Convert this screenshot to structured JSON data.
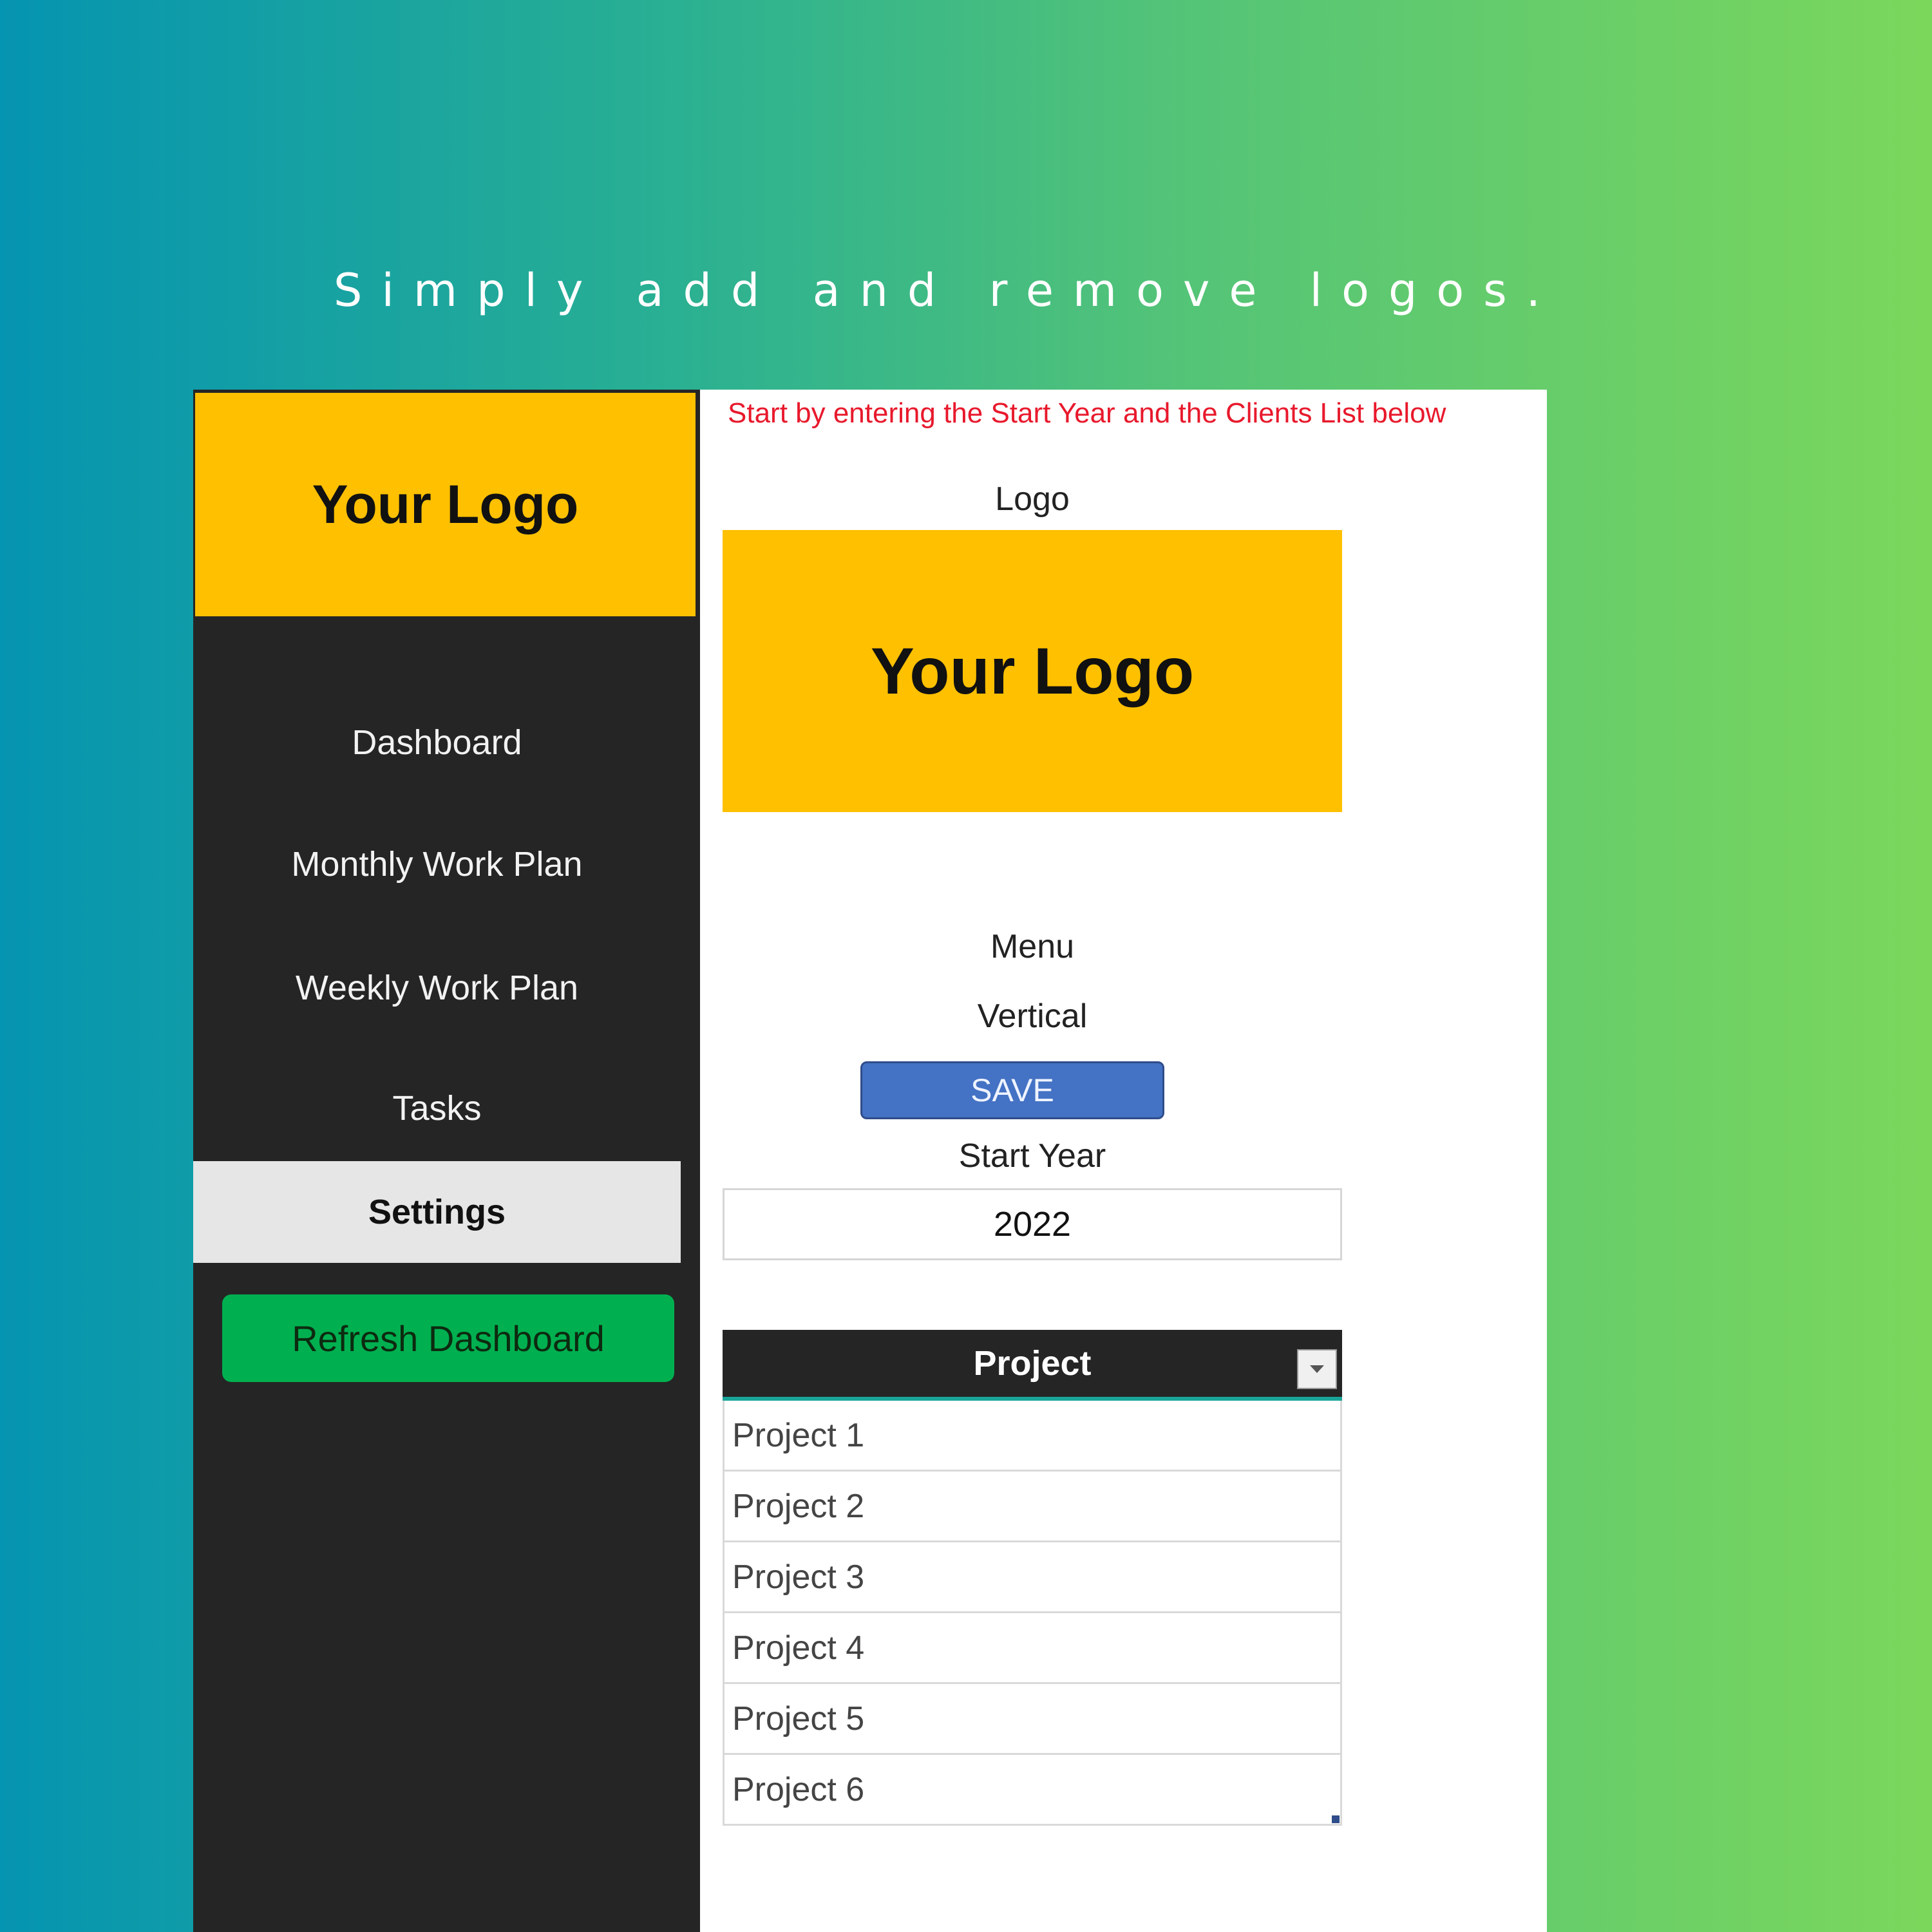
{
  "headline": "Simply add and remove logos.",
  "sidebar": {
    "logo_text": "Your Logo",
    "items": [
      {
        "label": "Dashboard"
      },
      {
        "label": "Monthly Work Plan"
      },
      {
        "label": "Weekly Work Plan"
      },
      {
        "label": "Tasks"
      },
      {
        "label": "Settings",
        "active": true
      }
    ],
    "refresh_label": "Refresh Dashboard"
  },
  "main": {
    "notice": "Start by entering the Start Year and the Clients List below",
    "logo_label": "Logo",
    "logo_text": "Your Logo",
    "menu_label": "Menu",
    "menu_value": "Vertical",
    "save_label": "SAVE",
    "start_year_label": "Start Year",
    "start_year_value": "2022",
    "table": {
      "header": "Project",
      "rows": [
        "Project 1",
        "Project 2",
        "Project 3",
        "Project 4",
        "Project 5",
        "Project 6"
      ]
    }
  },
  "colors": {
    "logo_bg": "#ffc000",
    "sidebar_bg": "#252525",
    "refresh_bg": "#00b050",
    "save_bg": "#4472c4",
    "notice_text": "#e8192c",
    "header_underline": "#1aa59a"
  },
  "icons": {
    "filter": "chevron-down-icon"
  }
}
